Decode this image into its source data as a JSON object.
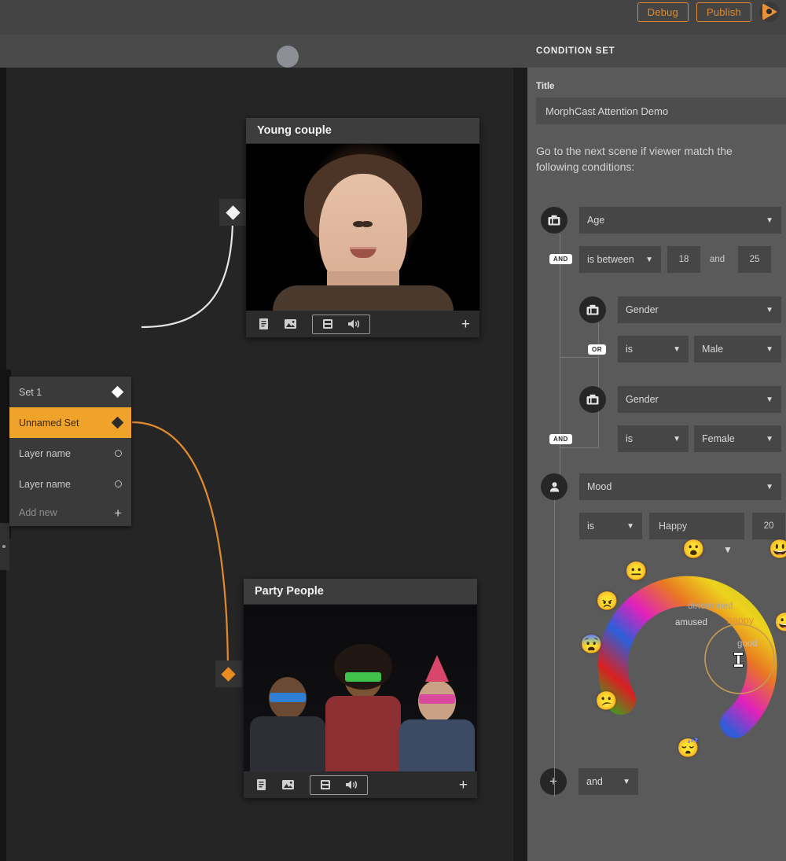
{
  "topbar": {
    "debug_label": "Debug",
    "publish_label": "Publish",
    "logo_name": "morphcast-logo"
  },
  "canvas": {
    "nodes": {
      "items": [
        {
          "label": "Set 1",
          "marker": "diamond",
          "selected": false
        },
        {
          "label": "Unnamed Set",
          "marker": "diamond",
          "selected": true
        },
        {
          "label": "Layer name",
          "marker": "circle",
          "selected": false
        },
        {
          "label": "Layer name",
          "marker": "circle",
          "selected": false
        }
      ],
      "add_new_label": "Add new"
    },
    "cards": [
      {
        "title": "Young couple",
        "media": "young-woman-portrait-video",
        "toolbar": {
          "icons": [
            "document-icon",
            "image-icon"
          ],
          "group_icons": [
            "video-icon",
            "volume-icon"
          ],
          "add_label": "+"
        }
      },
      {
        "title": "Party People",
        "media": "party-people-group-video",
        "toolbar": {
          "icons": [
            "document-icon",
            "image-icon"
          ],
          "group_icons": [
            "video-icon",
            "volume-icon"
          ],
          "add_label": "+"
        }
      }
    ]
  },
  "panel": {
    "header": "CONDITION SET",
    "title_field_label": "Title",
    "title_value": "MorphCast Attention Demo",
    "title_placeholder": "Title",
    "instruction": "Go to the next scene if viewer match the following conditions:",
    "conditions": [
      {
        "icon": "camera-icon",
        "attribute": "Age",
        "operator": "is between",
        "value_min": "18",
        "between_word": "and",
        "value_max": "25",
        "logic": "AND"
      },
      {
        "icon": "camera-icon",
        "attribute": "Gender",
        "operator": "is",
        "value": "Male",
        "logic": "OR"
      },
      {
        "icon": "camera-icon",
        "attribute": "Gender",
        "operator": "is",
        "value": "Female",
        "logic": "AND"
      },
      {
        "icon": "person-icon",
        "attribute": "Mood",
        "operator": "is",
        "value": "Happy",
        "threshold": "20"
      }
    ],
    "mood_wheel": {
      "labels": [
        {
          "text": "determined",
          "color": "#a6a6a6"
        },
        {
          "text": "amused",
          "color": "#d9d9d9"
        },
        {
          "text": "happy",
          "color": "#e2923a"
        },
        {
          "text": "good",
          "color": "#bdbdbd"
        }
      ],
      "emojis": [
        "😮",
        "😐",
        "😠",
        "😨",
        "😕",
        "😴",
        "😀",
        "😃"
      ]
    },
    "footer": {
      "add_label": "+",
      "logic_value": "and"
    }
  },
  "colors": {
    "accent_orange": "#e08a2e",
    "selected_row": "#f0a32a",
    "panel_bg": "#5a5a5a",
    "field_bg": "#464646"
  }
}
